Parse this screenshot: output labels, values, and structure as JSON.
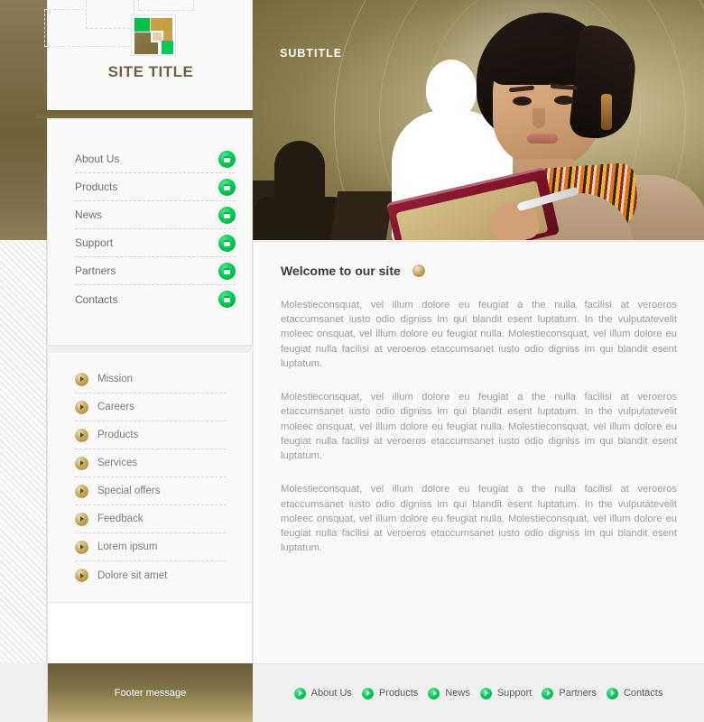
{
  "site": {
    "title": "SITE TITLE",
    "logo_icon": "tiled-squares-logo"
  },
  "hero": {
    "subtitle": "SUBTITLE",
    "image_description": "woman-with-red-portfolio",
    "silhouette_white": "person-silhouette",
    "accent_color": "#8a7d4f"
  },
  "sidebar": {
    "nav": [
      {
        "label": "About Us",
        "icon": "green-square-button"
      },
      {
        "label": "Products",
        "icon": "green-square-button"
      },
      {
        "label": "News",
        "icon": "green-square-button"
      },
      {
        "label": "Support",
        "icon": "green-square-button"
      },
      {
        "label": "Partners",
        "icon": "green-square-button"
      },
      {
        "label": "Contacts",
        "icon": "green-square-button"
      }
    ],
    "list": [
      {
        "label": "Mission",
        "icon": "gold-arrow-bullet"
      },
      {
        "label": "Careers",
        "icon": "gold-arrow-bullet"
      },
      {
        "label": "Products",
        "icon": "gold-arrow-bullet"
      },
      {
        "label": "Services",
        "icon": "gold-arrow-bullet"
      },
      {
        "label": "Special offers",
        "icon": "gold-arrow-bullet"
      },
      {
        "label": "Feedback",
        "icon": "gold-arrow-bullet"
      },
      {
        "label": "Lorem ipsum",
        "icon": "gold-arrow-bullet"
      },
      {
        "label": "Dolore sit amet",
        "icon": "gold-arrow-bullet"
      }
    ]
  },
  "main": {
    "heading": "Welcome to our site",
    "heading_bullet_icon": "gold-sphere-bullet",
    "paragraphs": [
      "Molestieconsquat, vel illum dolore eu feugiat a the nulla facilisi at veroeros etaccumsanet iusto odio digniss im qui blandit esent luptatum. In the vulputatevelit moleec onsquat, vel illum dolore eu feugiat nulla. Molestieconsquat, vel illum dolore eu feugiat nulla facilisi at veroeros etaccumsanet iusto odio digniss im qui blandit esent luptatum.",
      "Molestieconsquat, vel illum dolore eu feugiat a the nulla facilisi at veroeros etaccumsanet iusto odio digniss im qui blandit esent luptatum. In the vulputatevelit moleec onsquat, vel illum dolore eu feugiat nulla. Molestieconsquat, vel illum dolore eu feugiat nulla facilisi at veroeros etaccumsanet iusto odio digniss im qui blandit esent luptatum.",
      "Molestieconsquat, vel illum dolore eu feugiat a the nulla facilisi at veroeros etaccumsanet iusto odio digniss im qui blandit esent luptatum. In the vulputatevelit moleec onsquat, vel illum dolore eu feugiat nulla. Molestieconsquat, vel illum dolore eu feugiat nulla facilisi at veroeros etaccumsanet iusto odio digniss im qui blandit esent luptatum."
    ]
  },
  "footer": {
    "message": "Footer message",
    "nav": [
      {
        "label": "About Us",
        "icon": "green-play-bullet"
      },
      {
        "label": "Products",
        "icon": "green-play-bullet"
      },
      {
        "label": "News",
        "icon": "green-play-bullet"
      },
      {
        "label": "Support",
        "icon": "green-play-bullet"
      },
      {
        "label": "Partners",
        "icon": "green-play-bullet"
      },
      {
        "label": "Contacts",
        "icon": "green-play-bullet"
      }
    ]
  }
}
